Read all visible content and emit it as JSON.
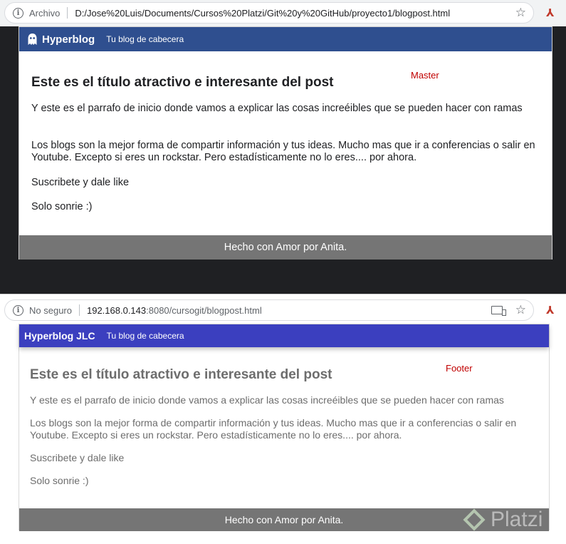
{
  "top_window": {
    "url_scheme": "Archivo",
    "url_path": "D:/Jose%20Luis/Documents/Cursos%20Platzi/Git%20y%20GitHub/proyecto1/blogpost.html",
    "brand": "Hyperblog",
    "tagline": "Tu blog de cabecera",
    "annotation": "Master",
    "title": "Este es el título atractivo e interesante del post",
    "paragraphs": [
      "Y este es el parrafo de inicio donde vamos a explicar las cosas increéibles que se pueden hacer con ramas",
      "Los blogs son la mejor forma de compartir información y tus ideas. Mucho mas que ir a conferencias o salir en Youtube. Excepto si eres un rockstar. Pero estadísticamente no lo eres.... por ahora.",
      "Suscribete y dale like",
      "Solo sonrie :)"
    ],
    "footer": "Hecho con Amor por Anita."
  },
  "bottom_window": {
    "url_scheme": "No seguro",
    "url_host": "192.168.0.143",
    "url_rest": ":8080/cursogit/blogpost.html",
    "brand": "Hyperblog JLC",
    "tagline": "Tu blog de cabecera",
    "annotation": "Footer",
    "title": "Este es el título atractivo e interesante del post",
    "paragraphs": [
      "Y este es el parrafo de inicio donde vamos a explicar las cosas increéibles que se pueden hacer con ramas",
      "Los blogs son la mejor forma de compartir información y tus ideas. Mucho mas que ir a conferencias o salir en Youtube. Excepto si eres un rockstar. Pero estadísticamente no lo eres.... por ahora.",
      "Suscribete y dale like",
      "Solo sonrie :)"
    ],
    "footer": "Hecho con Amor por Anita."
  },
  "icons": {
    "info": "info-icon",
    "star": "bookmark-star-icon",
    "pdf": "pdf-extension-icon",
    "cast": "cast-icon",
    "ghost": "ghost-logo-icon"
  },
  "colors": {
    "navbar_top": "#2f4f8f",
    "navbar_bottom": "#3b3fbf",
    "footer": "#757575",
    "annotation": "#c00000"
  },
  "watermark": "Platzi"
}
